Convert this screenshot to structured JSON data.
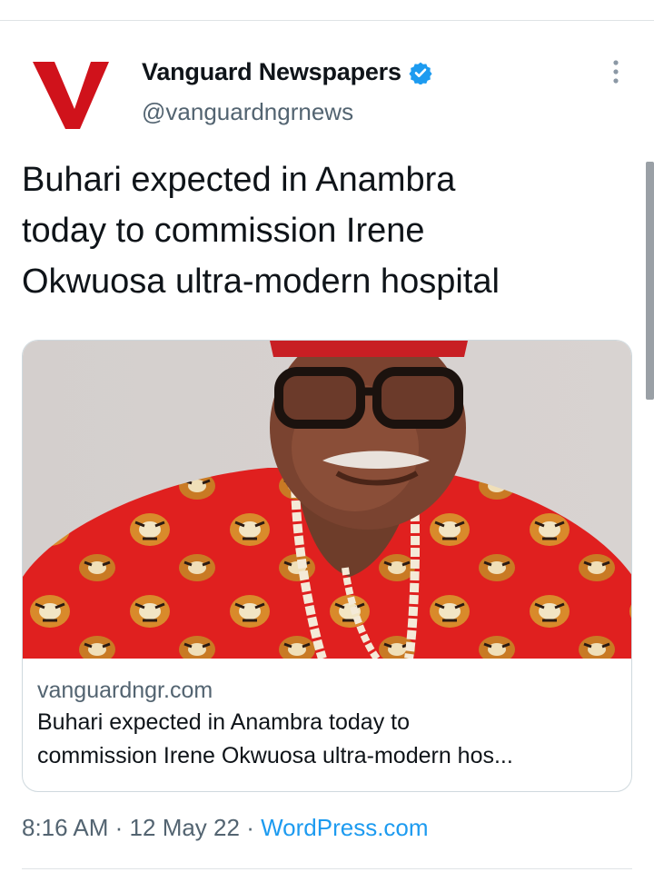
{
  "tweet": {
    "display_name": "Vanguard Newspapers",
    "handle": "@vanguardngrnews",
    "verified": true,
    "text_line1": "Buhari expected in Anambra",
    "text_line2": "today to commission Irene",
    "text_line3": "Okwuosa ultra-modern hospital",
    "time": "8:16 AM",
    "separator": "·",
    "date": "12 May 22",
    "source": "WordPress.com"
  },
  "card": {
    "domain": "vanguardngr.com",
    "title_line1": "Buhari expected in Anambra today to",
    "title_line2": "commission Irene Okwuosa ultra-modern hos..."
  },
  "icons": {
    "logo": "vanguard-v-logo",
    "verified": "verified-badge-icon",
    "more": "more-options-icon"
  },
  "colors": {
    "logo_red": "#d0121b",
    "verified_blue": "#1d9bf0",
    "link_blue": "#1d9bf0",
    "secondary_text": "#536471"
  }
}
